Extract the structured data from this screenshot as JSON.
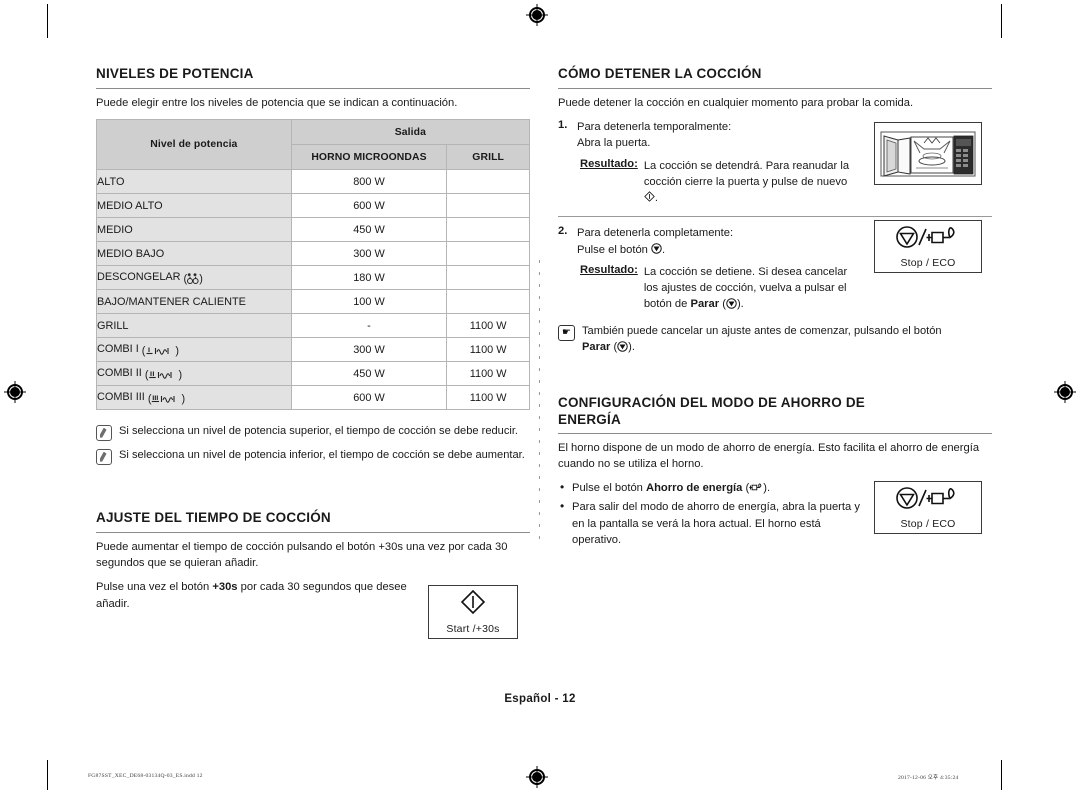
{
  "document": {
    "page_label": "Español - 12",
    "footer_left": "FG87SST_XEC_DE68-03134Q-03_ES.indd   12",
    "footer_right": "2017-12-06   오후 4:35:24"
  },
  "left_column": {
    "power_levels": {
      "heading": "NIVELES DE POTENCIA",
      "intro": "Puede elegir entre los niveles de potencia que se indican a continuación.",
      "table": {
        "header_name": "Nivel de potencia",
        "header_output": "Salida",
        "header_microwave": "HORNO MICROONDAS",
        "header_grill": "GRILL",
        "rows": [
          {
            "name": "ALTO",
            "symbol": "",
            "microwave": "800 W",
            "grill": ""
          },
          {
            "name": "MEDIO ALTO",
            "symbol": "",
            "microwave": "600 W",
            "grill": ""
          },
          {
            "name": "MEDIO",
            "symbol": "",
            "microwave": "450 W",
            "grill": ""
          },
          {
            "name": "MEDIO BAJO",
            "symbol": "",
            "microwave": "300 W",
            "grill": ""
          },
          {
            "name": "DESCONGELAR",
            "symbol": "defrost-icon",
            "microwave": "180 W",
            "grill": ""
          },
          {
            "name": "BAJO/MANTENER CALIENTE",
            "symbol": "",
            "microwave": "100 W",
            "grill": ""
          },
          {
            "name": "GRILL",
            "symbol": "",
            "microwave": "-",
            "grill": "1100 W"
          },
          {
            "name": "COMBI I",
            "symbol": "grill1-microwave-icon",
            "microwave": "300 W",
            "grill": "1100 W"
          },
          {
            "name": "COMBI II",
            "symbol": "grill2-microwave-icon",
            "microwave": "450 W",
            "grill": "1100 W"
          },
          {
            "name": "COMBI III",
            "symbol": "grill3-microwave-icon",
            "microwave": "600 W",
            "grill": "1100 W"
          }
        ]
      },
      "notes": [
        "Si selecciona un nivel de potencia superior, el tiempo de cocción se debe reducir.",
        "Si selecciona un nivel de potencia inferior, el tiempo de cocción se debe aumentar."
      ]
    },
    "cooking_time": {
      "heading": "AJUSTE DEL TIEMPO DE COCCIÓN",
      "paragraph_1": "Puede aumentar el tiempo de cocción pulsando el botón +30s una vez por cada 30 segundos que se quieran añadir.",
      "paragraph_2_pre": "Pulse una vez el botón ",
      "paragraph_2_bold": "+30s",
      "paragraph_2_post": " por cada 30 segundos que desee añadir.",
      "button": {
        "caption": "Start /+30s",
        "icon": "start-diamond-icon"
      }
    }
  },
  "right_column": {
    "stop_cooking": {
      "heading": "CÓMO DETENER LA COCCIÓN",
      "intro": "Puede detener la cocción en cualquier momento para probar la comida.",
      "steps": [
        {
          "num": "1.",
          "text_line_1": "Para detenerla temporalmente:",
          "text_line_2": "Abra la puerta.",
          "result_label": "Resultado:",
          "result_text": "La cocción se detendrá. Para reanudar la cocción cierre la puerta y pulse de nuevo ",
          "result_icon": "start-diamond-icon",
          "result_tail": "."
        },
        {
          "num": "2.",
          "text_line_1": "Para detenerla completamente:",
          "text_line_2_pre": "Pulse el botón ",
          "text_line_2_icon": "stop-icon",
          "text_line_2_post": ".",
          "result_label": "Resultado:",
          "result_text": "La cocción se detiene. Si desea cancelar los ajustes de cocción, vuelva a pulsar el botón de ",
          "result_bold": "Parar",
          "result_icon": "stop-icon",
          "result_tail": ")."
        }
      ],
      "note_pre": "También puede cancelar un ajuste antes de comenzar, pulsando el botón ",
      "note_bold": "Parar",
      "note_icon": "stop-icon",
      "note_post": ").",
      "illustrations": {
        "oven_icon": "microwave-oven-open-door-icon",
        "stop_button": {
          "caption": "Stop / ECO",
          "icon": "stop-eco-icon"
        }
      }
    },
    "energy_saving": {
      "heading_line_1": "CONFIGURACIÓN DEL MODO DE AHORRO DE",
      "heading_line_2": "ENERGÍA",
      "intro": "El horno dispone de un modo de ahorro de energía. Esto facilita el ahorro de energía cuando no se utiliza el horno.",
      "bullets": [
        {
          "pre": "Pulse el botón ",
          "bold": "Ahorro de energía",
          "icon": "eco-plug-icon",
          "post": ")."
        },
        {
          "pre": "Para salir del modo de ahorro de energía, abra la puerta y en la pantalla se verá la hora actual. El horno está operativo.",
          "bold": "",
          "icon": "",
          "post": ""
        }
      ],
      "button": {
        "caption": "Stop / ECO",
        "icon": "stop-eco-icon"
      }
    }
  },
  "colors": {
    "table_header_bg": "#cfcfcf",
    "table_row_label_bg": "#e2e2e2",
    "rule": "#8b8b8b",
    "text": "#1a1a1a"
  }
}
